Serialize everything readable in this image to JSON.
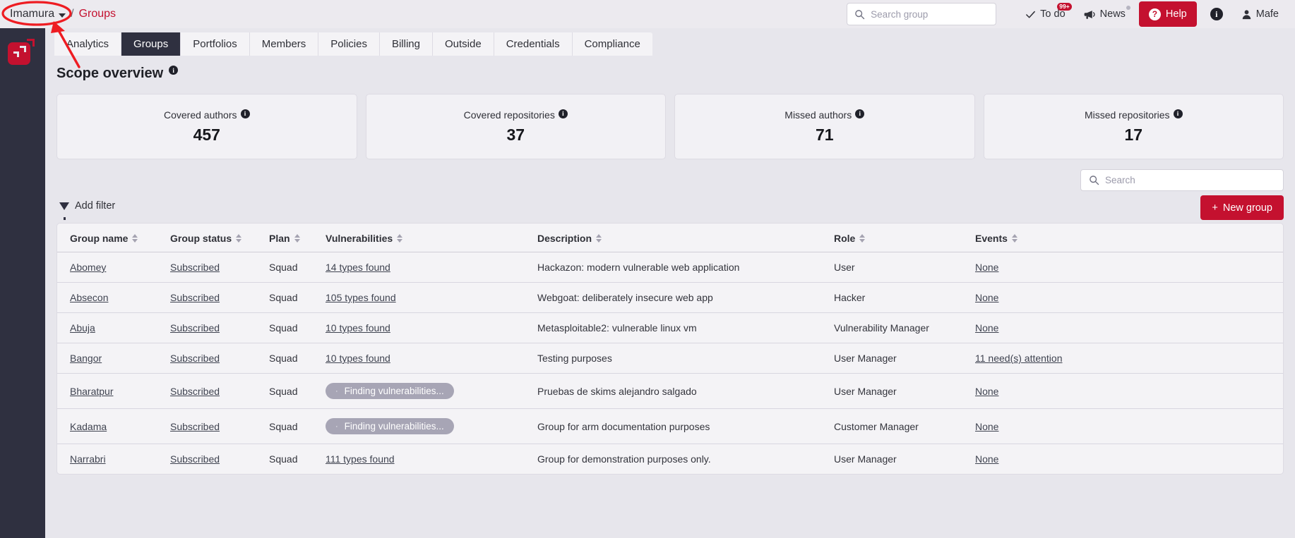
{
  "header": {
    "breadcrumb": {
      "org": "Imamura",
      "separator": "/",
      "current": "Groups"
    },
    "search": {
      "placeholder": "Search group",
      "value": ""
    },
    "todo": {
      "label": "To do",
      "badge": "99+"
    },
    "news": {
      "label": "News"
    },
    "help": {
      "label": "Help"
    },
    "info": {
      "label": "i"
    },
    "user": {
      "name": "Mafe"
    }
  },
  "tabs": [
    {
      "label": "Analytics",
      "active": false
    },
    {
      "label": "Groups",
      "active": true
    },
    {
      "label": "Portfolios",
      "active": false
    },
    {
      "label": "Members",
      "active": false
    },
    {
      "label": "Policies",
      "active": false
    },
    {
      "label": "Billing",
      "active": false
    },
    {
      "label": "Outside",
      "active": false
    },
    {
      "label": "Credentials",
      "active": false
    },
    {
      "label": "Compliance",
      "active": false
    }
  ],
  "scope": {
    "title": "Scope overview",
    "cards": [
      {
        "label": "Covered authors",
        "value": "457"
      },
      {
        "label": "Covered repositories",
        "value": "37"
      },
      {
        "label": "Missed authors",
        "value": "71"
      },
      {
        "label": "Missed repositories",
        "value": "17"
      }
    ]
  },
  "toolbar": {
    "search_placeholder": "Search",
    "search_value": "",
    "add_filter_label": "Add filter",
    "new_group_label": "New group",
    "plus": "+"
  },
  "table": {
    "columns": [
      "Group name",
      "Group status",
      "Plan",
      "Vulnerabilities",
      "Description",
      "Role",
      "Events"
    ],
    "rows": [
      {
        "name": "Abomey",
        "status": "Subscribed",
        "plan": "Squad",
        "vulnerabilities": "14 types found",
        "vuln_pending": false,
        "description": "Hackazon: modern vulnerable web application",
        "role": "User",
        "events": "None"
      },
      {
        "name": "Absecon",
        "status": "Subscribed",
        "plan": "Squad",
        "vulnerabilities": "105 types found",
        "vuln_pending": false,
        "description": "Webgoat: deliberately insecure web app",
        "role": "Hacker",
        "events": "None"
      },
      {
        "name": "Abuja",
        "status": "Subscribed",
        "plan": "Squad",
        "vulnerabilities": "10 types found",
        "vuln_pending": false,
        "description": "Metasploitable2: vulnerable linux vm",
        "role": "Vulnerability Manager",
        "events": "None"
      },
      {
        "name": "Bangor",
        "status": "Subscribed",
        "plan": "Squad",
        "vulnerabilities": "10 types found",
        "vuln_pending": false,
        "description": "Testing purposes",
        "role": "User Manager",
        "events": "11 need(s) attention"
      },
      {
        "name": "Bharatpur",
        "status": "Subscribed",
        "plan": "Squad",
        "vulnerabilities": "Finding vulnerabilities...",
        "vuln_pending": true,
        "description": "Pruebas de skims alejandro salgado",
        "role": "User Manager",
        "events": "None"
      },
      {
        "name": "Kadama",
        "status": "Subscribed",
        "plan": "Squad",
        "vulnerabilities": "Finding vulnerabilities...",
        "vuln_pending": true,
        "description": "Group for arm documentation purposes",
        "role": "Customer Manager",
        "events": "None"
      },
      {
        "name": "Narrabri",
        "status": "Subscribed",
        "plan": "Squad",
        "vulnerabilities": "111 types found",
        "vuln_pending": false,
        "description": "Group for demonstration purposes only.",
        "role": "User Manager",
        "events": "None"
      }
    ]
  },
  "colors": {
    "brand_red": "#c4112f",
    "rail_dark": "#2f3040",
    "page_bg": "#e7e6ec",
    "annotation_red": "#ee1c22"
  }
}
